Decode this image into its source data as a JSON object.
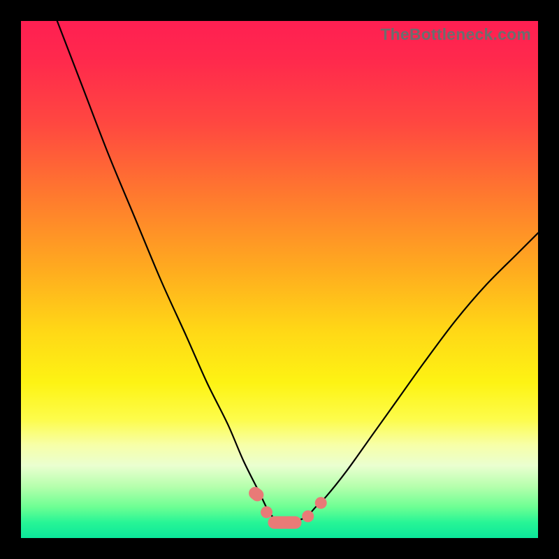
{
  "watermark": "TheBottleneck.com",
  "colors": {
    "frame": "#000000",
    "curve": "#000000",
    "beads": "#e97a77",
    "gradient_stops": [
      "#ff1f52",
      "#ff2a4c",
      "#ff4840",
      "#ff7a2e",
      "#ffab1f",
      "#ffd816",
      "#fdf314",
      "#fdfc4a",
      "#f7ffa8",
      "#eaffd0",
      "#b6ffad",
      "#6dff93",
      "#27f596",
      "#0be79a"
    ]
  },
  "chart_data": {
    "type": "line",
    "title": "",
    "xlabel": "",
    "ylabel": "",
    "xlim": [
      0,
      100
    ],
    "ylim": [
      0,
      100
    ],
    "grid": false,
    "legend": false,
    "note": "Values are estimated from pixel positions; chart has no labeled axes or ticks. y represents height (bottleneck severity), minimum near x≈51 where the curve touches the green band.",
    "series": [
      {
        "name": "bottleneck-curve",
        "x": [
          7,
          12,
          17,
          22,
          27,
          32,
          36,
          40,
          43,
          46,
          48,
          50,
          52,
          55,
          57,
          59,
          63,
          68,
          73,
          78,
          84,
          90,
          96,
          100
        ],
        "y": [
          100,
          87,
          74,
          62,
          50,
          39,
          30,
          22,
          15,
          9,
          5,
          3,
          3,
          4,
          6,
          8,
          13,
          20,
          27,
          34,
          42,
          49,
          55,
          59
        ]
      }
    ],
    "markers": [
      {
        "kind": "pill",
        "x": 45.5,
        "y": 8.5,
        "len": 3.0
      },
      {
        "kind": "round",
        "x": 47.5,
        "y": 5.0
      },
      {
        "kind": "pill",
        "x": 51.0,
        "y": 3.0,
        "len": 6.5
      },
      {
        "kind": "round",
        "x": 55.5,
        "y": 4.2
      },
      {
        "kind": "round",
        "x": 58.0,
        "y": 6.8
      }
    ]
  }
}
